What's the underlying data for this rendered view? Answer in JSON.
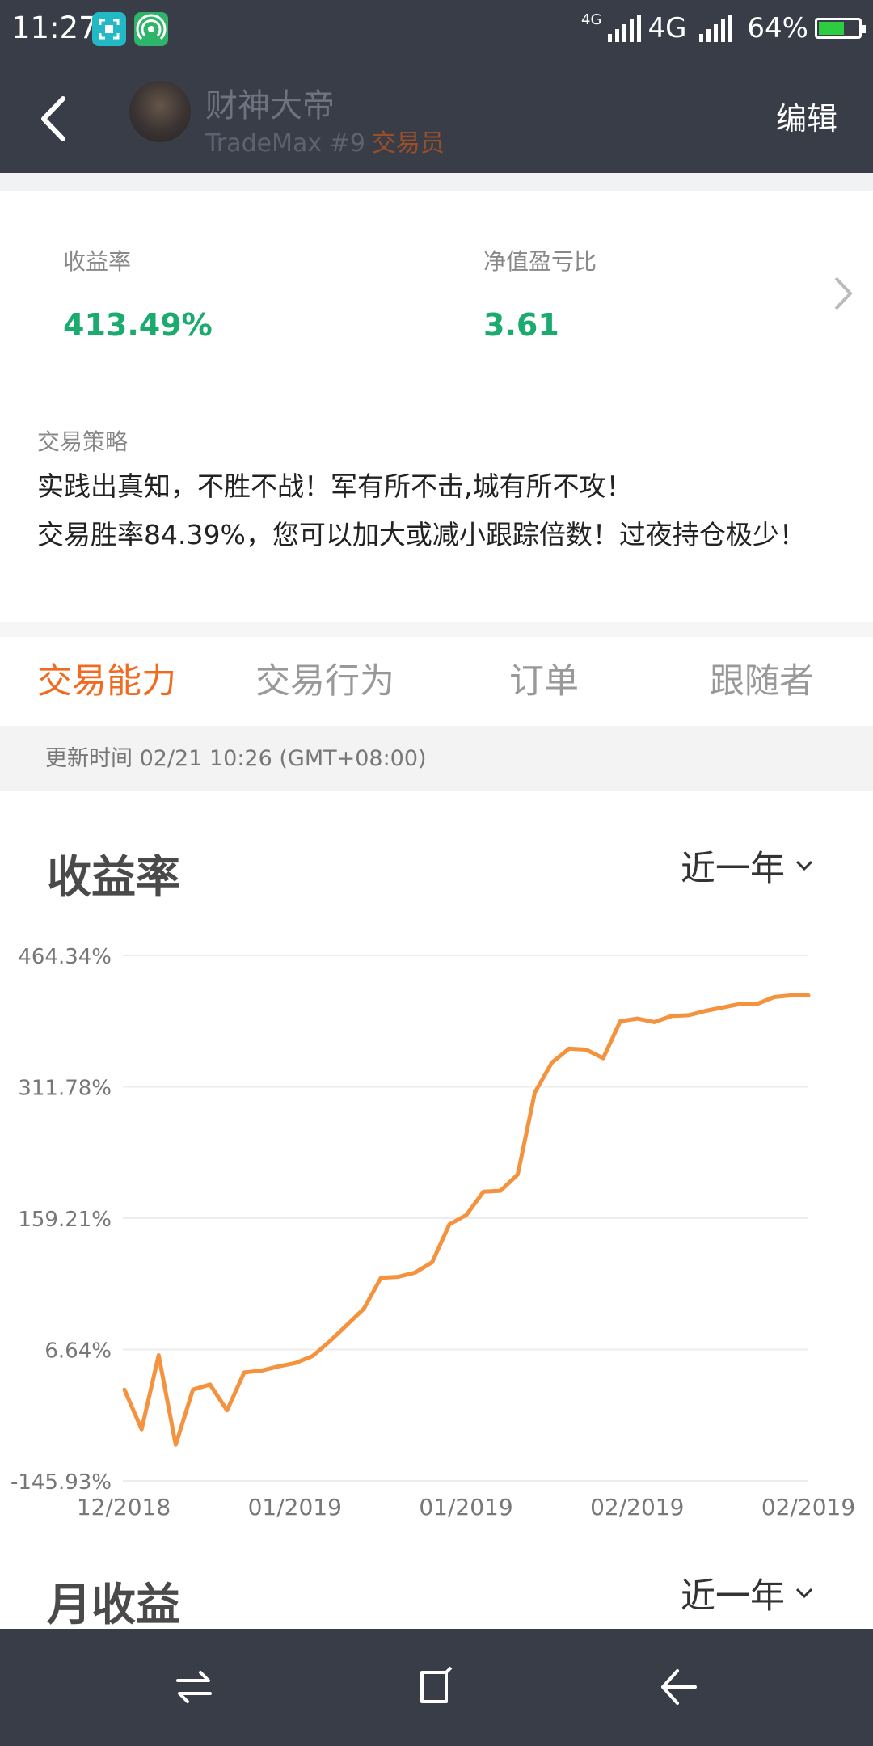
{
  "status_bar": {
    "time": "11:27",
    "network_small": "4G",
    "network": "4G",
    "battery": "64%",
    "battery_level": 0.64
  },
  "header": {
    "username": "财神大帝",
    "subtitle": "TradeMax #9",
    "role": "交易员",
    "edit_label": "编辑"
  },
  "stats": [
    {
      "label": "收益率",
      "value": "413.49%"
    },
    {
      "label": "净值盈亏比",
      "value": "3.61"
    }
  ],
  "strategy": {
    "label": "交易策略",
    "text": "实践出真知，不胜不战！军有所不击,城有所不攻！\n交易胜率84.39%，您可以加大或减小跟踪倍数！过夜持仓极少！"
  },
  "tabs": [
    "交易能力",
    "交易行为",
    "订单",
    "跟随者"
  ],
  "active_tab": 0,
  "update_time": "更新时间 02/21 10:26 (GMT+08:00)",
  "section1": {
    "title": "收益率",
    "range": "近一年"
  },
  "section2": {
    "title": "月收益",
    "range": "近一年"
  },
  "colors": {
    "accent": "#f06b1f",
    "positive": "#1bab6e",
    "line": "#f5923e",
    "header_bg": "#383d47"
  },
  "chart_data": {
    "type": "line",
    "y_ticks": [
      "464.34%",
      "311.78%",
      "159.21%",
      "6.64%",
      "-145.93%"
    ],
    "ylim": [
      -145.93,
      464.34
    ],
    "x_ticks": [
      "12/2018",
      "01/2019",
      "01/2019",
      "02/2019",
      "02/2019"
    ],
    "grid": true,
    "series": [
      {
        "values": [
          -40,
          -86,
          0,
          -104,
          -40,
          -34,
          -64,
          -20,
          -18,
          -13,
          -9,
          -1,
          16,
          35,
          54,
          90,
          91,
          96,
          108,
          152,
          163,
          190,
          191,
          210,
          305,
          340,
          356,
          355,
          345,
          388,
          391,
          387,
          394,
          395,
          400,
          404,
          408,
          408,
          416,
          418,
          418
        ]
      }
    ]
  }
}
